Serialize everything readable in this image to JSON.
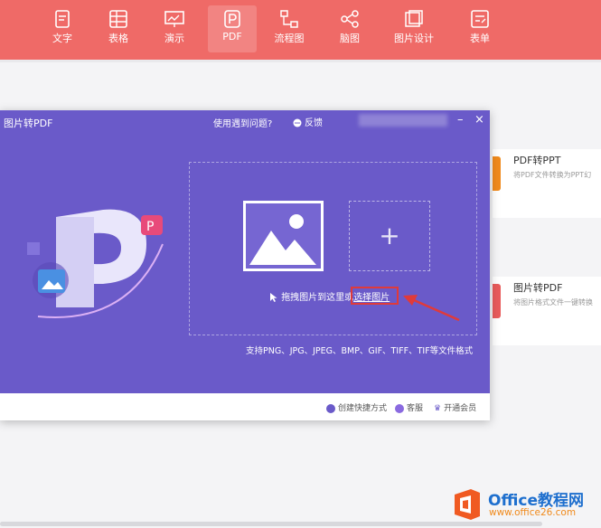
{
  "toolbar": {
    "items": [
      {
        "label": "文字",
        "icon": "document-icon"
      },
      {
        "label": "表格",
        "icon": "table-icon"
      },
      {
        "label": "演示",
        "icon": "presentation-icon"
      },
      {
        "label": "PDF",
        "icon": "pdf-icon",
        "active": true
      },
      {
        "label": "流程图",
        "icon": "flowchart-icon"
      },
      {
        "label": "脑图",
        "icon": "mindmap-icon"
      },
      {
        "label": "图片设计",
        "icon": "image-design-icon"
      },
      {
        "label": "表单",
        "icon": "form-icon"
      }
    ]
  },
  "cards": [
    {
      "title": "PDF转PPT",
      "subtitle": "将PDF文件转换为PPT幻",
      "color": "#f08a1c"
    },
    {
      "title": "图片转PDF",
      "subtitle": "将图片格式文件一键转换",
      "color": "#e85b5b"
    }
  ],
  "dialog": {
    "title": "图片转PDF",
    "help": "使用遇到问题?",
    "feedback": "反馈",
    "drop_hint": "拖拽图片到这里或",
    "choose_link": "选择图片",
    "add_symbol": "+",
    "formats": "支持PNG、JPG、JPEG、BMP、GIF、TIFF、TIF等文件格式",
    "footer": {
      "shortcut": "创建快捷方式",
      "service": "客服",
      "vip": "开通会员"
    },
    "accent": "#6a5ac9"
  },
  "logo": {
    "name": "Office教程网",
    "url": "www.office26.com"
  }
}
